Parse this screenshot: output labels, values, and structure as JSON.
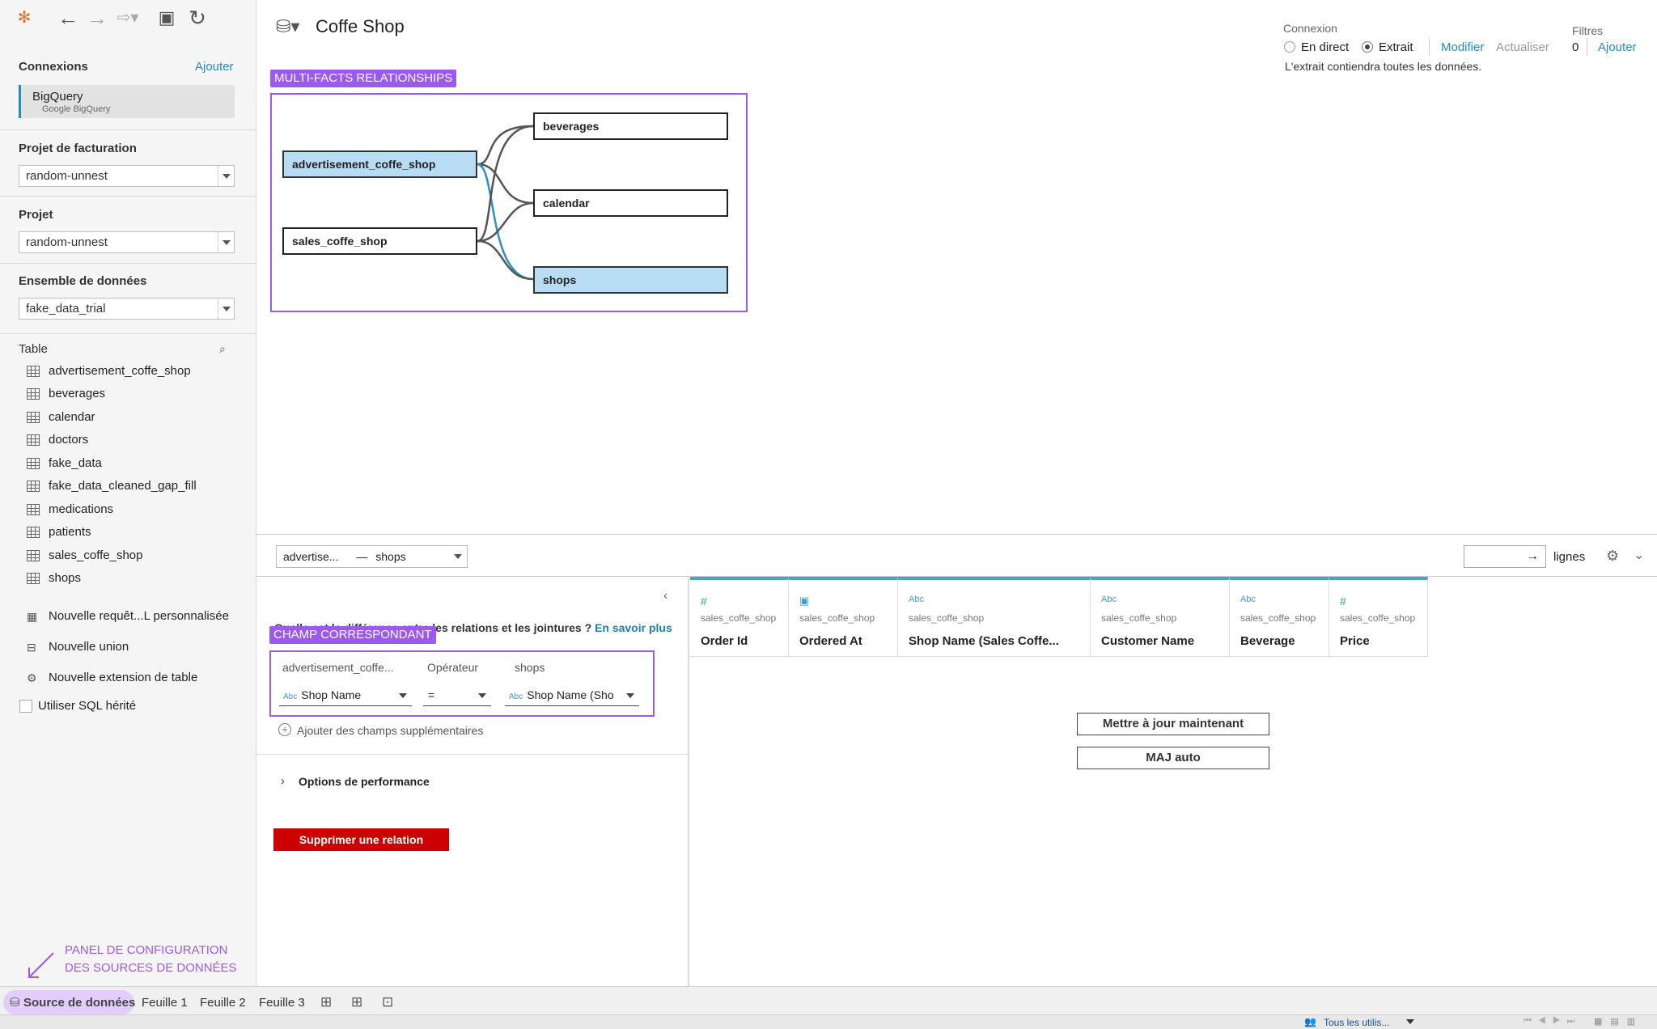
{
  "toolbar": {
    "icons": [
      "tableau-logo-icon",
      "back-icon",
      "forward-icon",
      "redo-icon",
      "save-icon",
      "refresh-icon"
    ]
  },
  "sidebar": {
    "connections_title": "Connexions",
    "add_connection": "Ajouter",
    "connection": {
      "name": "BigQuery",
      "subtitle": "Google BigQuery"
    },
    "billing_project_title": "Projet de facturation",
    "billing_project_value": "random-unnest",
    "project_title": "Projet",
    "project_value": "random-unnest",
    "dataset_title": "Ensemble de données",
    "dataset_value": "fake_data_trial",
    "table_title": "Table",
    "tables": [
      {
        "label": "advertisement_coffe_shop"
      },
      {
        "label": "beverages"
      },
      {
        "label": "calendar"
      },
      {
        "label": "doctors"
      },
      {
        "label": "fake_data"
      },
      {
        "label": "fake_data_cleaned_gap_fill"
      },
      {
        "label": "medications"
      },
      {
        "label": "patients"
      },
      {
        "label": "sales_coffe_shop"
      },
      {
        "label": "shops"
      }
    ],
    "actions": [
      {
        "label": "Nouvelle requêt...L personnalisée"
      },
      {
        "label": "Nouvelle union"
      },
      {
        "label": "Nouvelle extension de table"
      }
    ],
    "legacy_sql": "Utiliser SQL hérité",
    "annotation": "PANEL DE CONFIGURATION\nDES SOURCES DE DONNÉES"
  },
  "header": {
    "title": "Coffe Shop",
    "connexion_label": "Connexion",
    "live_label": "En direct",
    "extract_label": "Extrait",
    "modify_label": "Modifier",
    "refresh_label": "Actualiser",
    "extract_note": "L'extrait contiendra toutes les données.",
    "filters_label": "Filtres",
    "filters_count": "0",
    "filters_add": "Ajouter"
  },
  "canvas": {
    "annotation": "MULTI-FACTS RELATIONSHIPS",
    "nodes": {
      "advertisement": "advertisement_coffe_shop",
      "sales": "sales_coffe_shop",
      "beverages": "beverages",
      "calendar": "calendar",
      "shops": "shops"
    }
  },
  "relation_bar": {
    "left": "advertise...",
    "right": "shops",
    "rows_label": "lignes"
  },
  "relation_panel": {
    "question": "Quelle est la différence entre les relations et les jointures ?",
    "learn_more": "En savoir plus",
    "annotation": "CHAMP CORRESPONDANT",
    "left_header": "advertisement_coffe...",
    "operator_header": "Opérateur",
    "right_header": "shops",
    "left_field": "Shop Name",
    "operator": "=",
    "right_field": "Shop Name (Sho",
    "add_fields": "Ajouter des champs supplémentaires",
    "performance": "Options de performance",
    "delete": "Supprimer une relation"
  },
  "grid": {
    "columns": [
      {
        "type": "#",
        "source": "sales_coffe_shop",
        "name": "Order Id"
      },
      {
        "type": "date",
        "source": "sales_coffe_shop",
        "name": "Ordered At"
      },
      {
        "type": "Abc",
        "source": "sales_coffe_shop",
        "name": "Shop Name (Sales Coffe..."
      },
      {
        "type": "Abc",
        "source": "sales_coffe_shop",
        "name": "Customer Name"
      },
      {
        "type": "Abc",
        "source": "sales_coffe_shop",
        "name": "Beverage"
      },
      {
        "type": "#",
        "source": "sales_coffe_shop",
        "name": "Price"
      }
    ],
    "update_now": "Mettre à jour maintenant",
    "auto_update": "MAJ auto"
  },
  "tabs": {
    "datasource": "Source de données",
    "sheet1": "Feuille 1",
    "sheet2": "Feuille 2",
    "sheet3": "Feuille 3"
  },
  "status": {
    "users": "Tous les utilis..."
  },
  "colors": {
    "accent": "#1f8ec6",
    "annotation": "#9b59f0",
    "delete": "#cc0000",
    "selected_node": "#b8dcf3"
  }
}
